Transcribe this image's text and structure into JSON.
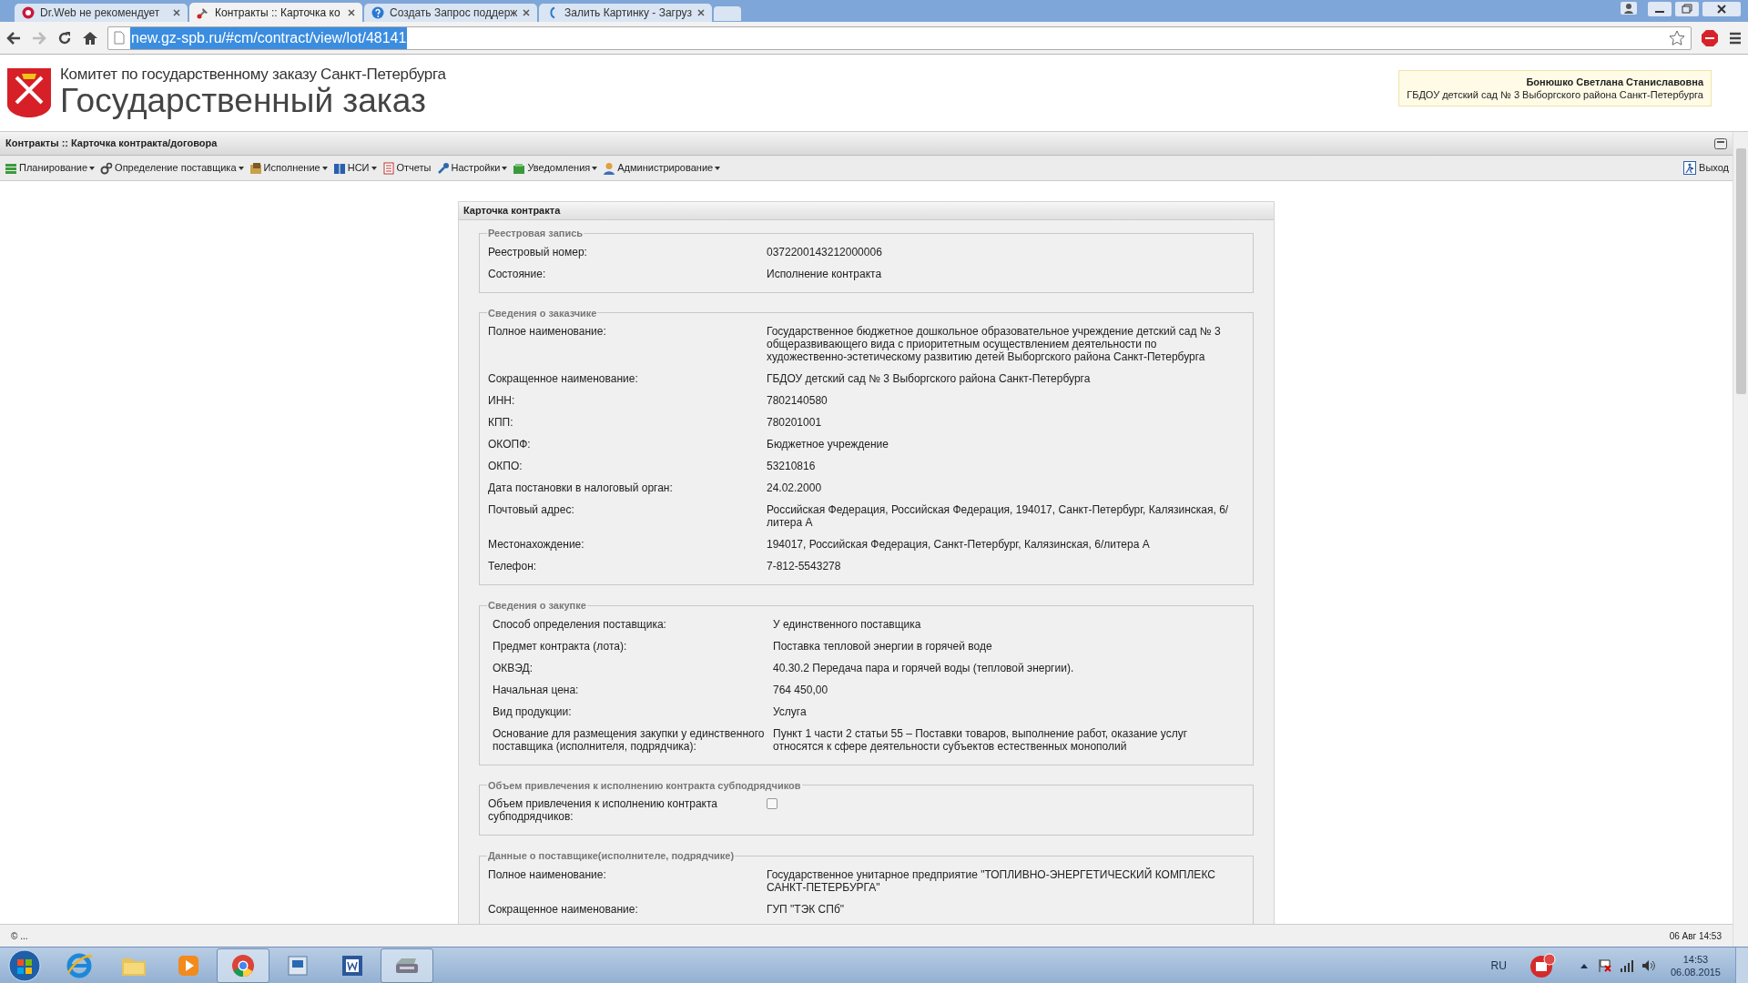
{
  "browser": {
    "tabs": [
      {
        "title": "Dr.Web не рекомендует",
        "selected": false
      },
      {
        "title": "Контракты :: Карточка ко",
        "selected": true
      },
      {
        "title": "Создать Запрос поддерж",
        "selected": false
      },
      {
        "title": "Залить Картинку - Загруз",
        "selected": false
      }
    ],
    "url": "new.gz-spb.ru/#cm/contract/view/lot/48141"
  },
  "header": {
    "org_line": "Комитет по государственному заказу Санкт-Петербурга",
    "title": "Государственный заказ",
    "user": {
      "name": "Бонюшко Светлана Станиславовна",
      "org": "ГБДОУ детский сад № 3 Выборгского района Санкт-Петербурга"
    }
  },
  "page_title": "Контракты :: Карточка контракта/договора",
  "menu": [
    {
      "label": "Планирование",
      "dropdown": true
    },
    {
      "label": "Определение поставщика",
      "dropdown": true
    },
    {
      "label": "Исполнение",
      "dropdown": true
    },
    {
      "label": "НСИ",
      "dropdown": true
    },
    {
      "label": "Отчеты",
      "dropdown": false
    },
    {
      "label": "Настройки",
      "dropdown": true
    },
    {
      "label": "Уведомления",
      "dropdown": true
    },
    {
      "label": "Администрирование",
      "dropdown": true
    }
  ],
  "logout": "Выход",
  "card": {
    "title": "Карточка контракта",
    "sections": [
      {
        "title": "Реестровая запись",
        "rows": [
          {
            "kind": "text",
            "label": "Реестровый номер:",
            "value": "0372200143212000006"
          },
          {
            "kind": "text",
            "label": "Состояние:",
            "value": "Исполнение контракта"
          }
        ]
      },
      {
        "title": "Сведения о заказчике",
        "rows": [
          {
            "kind": "text",
            "label": "Полное наименование:",
            "value": "Государственное бюджетное дошкольное образовательное учреждение детский сад № 3 общеразвивающего вида с приоритетным осуществлением деятельности по художественно-эстетическому развитию детей Выборгского района Санкт-Петербурга"
          },
          {
            "kind": "text",
            "label": "Сокращенное наименование:",
            "value": "ГБДОУ детский сад № 3 Выборгского района Санкт-Петербурга"
          },
          {
            "kind": "text",
            "label": "ИНН:",
            "value": "7802140580"
          },
          {
            "kind": "text",
            "label": "КПП:",
            "value": "780201001"
          },
          {
            "kind": "text",
            "label": "ОКОПФ:",
            "value": "Бюджетное учреждение"
          },
          {
            "kind": "text",
            "label": "ОКПО:",
            "value": "53210816"
          },
          {
            "kind": "text",
            "label": "Дата постановки в налоговый орган:",
            "value": "24.02.2000"
          },
          {
            "kind": "text",
            "label": "Почтовый адрес:",
            "value": "Российская Федерация, Российская Федерация, 194017, Санкт-Петербург, Калязинская, 6/литера А"
          },
          {
            "kind": "text",
            "label": "Местонахождение:",
            "value": "194017, Российская Федерация, Санкт-Петербург, Калязинская, 6/литера А"
          },
          {
            "kind": "text",
            "label": "Телефон:",
            "value": "7-812-5543278"
          }
        ]
      },
      {
        "title": "Сведения о закупке",
        "compact": true,
        "rows": [
          {
            "kind": "text",
            "label": "Способ определения поставщика:",
            "value": "У единственного поставщика"
          },
          {
            "kind": "text",
            "label": "Предмет контракта (лота):",
            "value": "Поставка тепловой энергии в горячей воде"
          },
          {
            "kind": "text",
            "label": "ОКВЭД:",
            "value": "40.30.2 Передача пара и горячей воды (тепловой энергии)."
          },
          {
            "kind": "text",
            "label": "Начальная цена:",
            "value": "764 450,00"
          },
          {
            "kind": "text",
            "label": "Вид продукции:",
            "value": "Услуга"
          },
          {
            "kind": "text",
            "label": "Основание для размещения закупки у единственного поставщика (исполнителя, подрядчика):",
            "value": "Пункт 1 части 2 статьи 55 – Поставки товаров, выполнение работ, оказание услуг относятся к сфере деятельности субъектов естественных монополий"
          }
        ]
      },
      {
        "title": "Объем привлечения к исполнению контракта субподрядчиков",
        "rows": [
          {
            "kind": "checkbox",
            "label": "Объем привлечения к исполнению контракта субподрядчиков:",
            "checked": false
          }
        ]
      },
      {
        "title": "Данные о поставщике(исполнителе, подрядчике)",
        "rows": [
          {
            "kind": "text",
            "label": "Полное наименование:",
            "value": "Государственное унитарное предприятие \"ТОПЛИВНО-ЭНЕРГЕТИЧЕСКИЙ КОМПЛЕКС САНКТ-ПЕТЕРБУРГА\""
          },
          {
            "kind": "text",
            "label": "Сокращенное наименование:",
            "value": "ГУП \"ТЭК СПб\""
          }
        ]
      }
    ]
  },
  "status_bar": {
    "left": "© ...",
    "right": "06 Авг 14:53"
  },
  "taskbar": {
    "apps": [
      {
        "active": false
      },
      {
        "active": false
      },
      {
        "active": false
      },
      {
        "active": true
      },
      {
        "active": false
      },
      {
        "active": false
      },
      {
        "active": true
      }
    ],
    "language": "RU",
    "time": "14:53",
    "date": "06.08.2015"
  }
}
